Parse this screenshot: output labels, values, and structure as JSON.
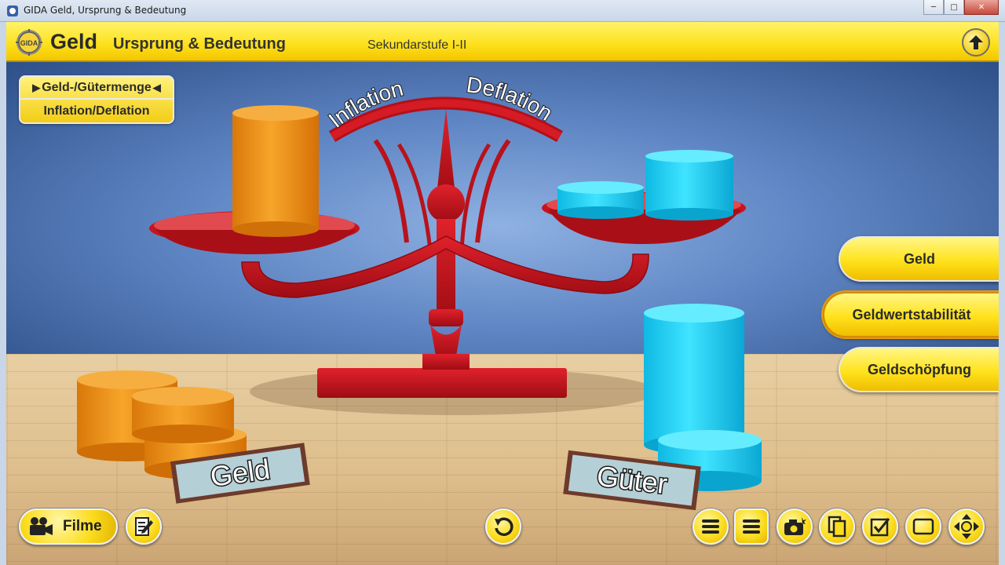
{
  "window": {
    "title": "GIDA Geld, Ursprung & Bedeutung",
    "minimize": "─",
    "maximize": "□",
    "close": "✕"
  },
  "header": {
    "logo_text": "GIDA",
    "title": "Geld",
    "subtitle": "Ursprung & Bedeutung",
    "level": "Sekundarstufe I-II",
    "up_icon": "arrow-up-icon"
  },
  "topic_menu": {
    "items": [
      {
        "label": "Geld-/Gütermenge",
        "selected": true
      },
      {
        "label": "Inflation/Deflation",
        "selected": false
      }
    ]
  },
  "scale": {
    "left_label": "Inflation",
    "right_label": "Deflation",
    "color": "#c4121b"
  },
  "table_signs": {
    "money": "Geld",
    "goods": "Güter"
  },
  "colors": {
    "money": "#f39a1a",
    "goods": "#19d3f5",
    "accent": "#fde01a"
  },
  "side_nav": {
    "items": [
      {
        "label": "Geld",
        "active": false
      },
      {
        "label": "Geldwertstabilität",
        "active": true
      },
      {
        "label": "Geldschöpfung",
        "active": false
      }
    ]
  },
  "toolbar": {
    "films_label": "Filme",
    "icons": [
      "film-camera-icon",
      "notes-icon",
      "reset-icon",
      "list-menu-icon",
      "list-menu-icon",
      "camera-icon",
      "copy-icon",
      "checklist-icon",
      "fullscreen-icon",
      "navigation-pad-icon"
    ]
  }
}
